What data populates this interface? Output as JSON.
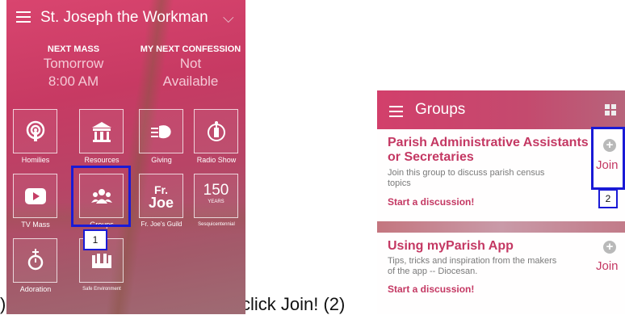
{
  "left_fragment": ")",
  "caption": "click Join! (2)",
  "screen1": {
    "title": "St. Joseph the Workman",
    "next_mass": {
      "label": "NEXT MASS",
      "line1": "Tomorrow",
      "line2": "8:00 AM"
    },
    "next_confession": {
      "label": "MY NEXT CONFESSION",
      "line1": "Not",
      "line2": "Available"
    },
    "tiles": [
      {
        "label": "Homilies",
        "icon": "podcast-icon"
      },
      {
        "label": "Resources",
        "icon": "library-icon"
      },
      {
        "label": "Giving",
        "icon": "giving-hand-icon"
      },
      {
        "label": "Radio Show",
        "icon": "radio-tower-icon"
      },
      {
        "label": "TV Mass",
        "icon": "play-icon"
      },
      {
        "label": "Groups",
        "icon": "people-icon"
      },
      {
        "label": "Fr. Joe's Guild",
        "icon": "fr-joe-icon",
        "icon_text_top": "Fr.",
        "icon_text_bottom": "Joe"
      },
      {
        "label": "Sesquicentennial",
        "icon": "150-years-icon",
        "icon_text_top": "150",
        "icon_text_bottom": "YEARS"
      },
      {
        "label": "Adoration",
        "icon": "monstrance-icon"
      },
      {
        "label": "Safe Environment",
        "icon": "group-hands-icon"
      }
    ],
    "step_badge": "1"
  },
  "screen2": {
    "title": "Groups",
    "groups": [
      {
        "title_line1": "Parish Administrative Assistants",
        "title_line2": "or Secretaries",
        "desc_line1": "Join this group to discuss parish census",
        "desc_line2": "topics",
        "link": "Start a discussion!",
        "join": "Join"
      },
      {
        "title_line1": "Using myParish App",
        "desc_line1": "Tips, tricks and inspiration from the makers",
        "desc_line2": "of the app -- Diocesan.",
        "link": "Start a discussion!",
        "join": "Join"
      }
    ],
    "step_badge": "2"
  },
  "colors": {
    "brand": "#c43863",
    "highlight": "#1a1ad6"
  }
}
